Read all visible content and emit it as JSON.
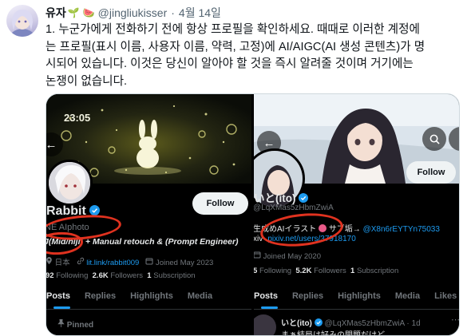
{
  "tweet": {
    "author_name": "유자",
    "emoji_1": "🌱",
    "emoji_2": "🍉",
    "handle": "@jingliukisser",
    "separator": "·",
    "date": "4월 14일",
    "text_lines": [
      "1. 누군가에게 전화하기 전에 항상 프로필을 확인하세요. 때때로 이러한 계정에",
      "는 프로필(표시 이름, 사용자 이름, 약력, 고정)에 AI/AIGC(AI 생성 콘텐츠)가 명",
      "시되어 있습니다. 이것은 당신이 알아야 할 것을 즉시 알려줄 것이며 거기에는",
      "논쟁이 없습니다."
    ]
  },
  "left_profile": {
    "banner_time": "23:05",
    "follow_label": "Follow",
    "display_name": "Rabbit",
    "handle_line": "NE AIphoto",
    "bio": "J(Mid/niji) + Manual retouch & (Prompt Engineer)",
    "location": "日本",
    "link": "lit.link/rabbit009",
    "joined": "Joined May 2023",
    "following_count": "92",
    "following_label": "Following",
    "followers_count": "2.6K",
    "followers_label": "Followers",
    "subscription_count": "1",
    "subscription_label": "Subscription",
    "tabs": [
      "Posts",
      "Replies",
      "Highlights",
      "Media"
    ],
    "pinned_label": "Pinned",
    "icons": [
      "back-arrow-icon",
      "verified-badge-icon",
      "location-icon",
      "link-icon",
      "calendar-icon",
      "pin-icon"
    ]
  },
  "right_profile": {
    "follow_label": "Follow",
    "display_name": "いと(ito)",
    "handle_line": "@LqXMas5zHbmZwiA",
    "bio_1_prefix": "生成",
    "bio_1_text": "めAIイラスト",
    "bio_1_mid": "サブ垢→",
    "bio_1_link": "@X8n6rEYTYn75033",
    "bio_2_prefix": "xiv-",
    "bio_2_link": "pixiv.net/users/37918170",
    "joined": "Joined May 2020",
    "following_count": "5",
    "following_label": "Following",
    "followers_count": "5.2K",
    "followers_label": "Followers",
    "subscription_count": "1",
    "subscription_label": "Subscription",
    "tabs": [
      "Posts",
      "Replies",
      "Highlights",
      "Media",
      "Likes"
    ],
    "post_author": "いと(ito)",
    "post_handle": "@LqXMas5zHbmZwiA · 1d",
    "post_text": "まぁ結局は好みの問題だけど",
    "icons": [
      "back-arrow-icon",
      "search-icon",
      "more-icon",
      "verified-badge-icon",
      "calendar-icon",
      "more-horizontal-icon"
    ]
  },
  "colors": {
    "annotation": "#e0321f",
    "link": "#1d9bf0",
    "dim": "#71767b",
    "dark_bg": "#000000"
  }
}
